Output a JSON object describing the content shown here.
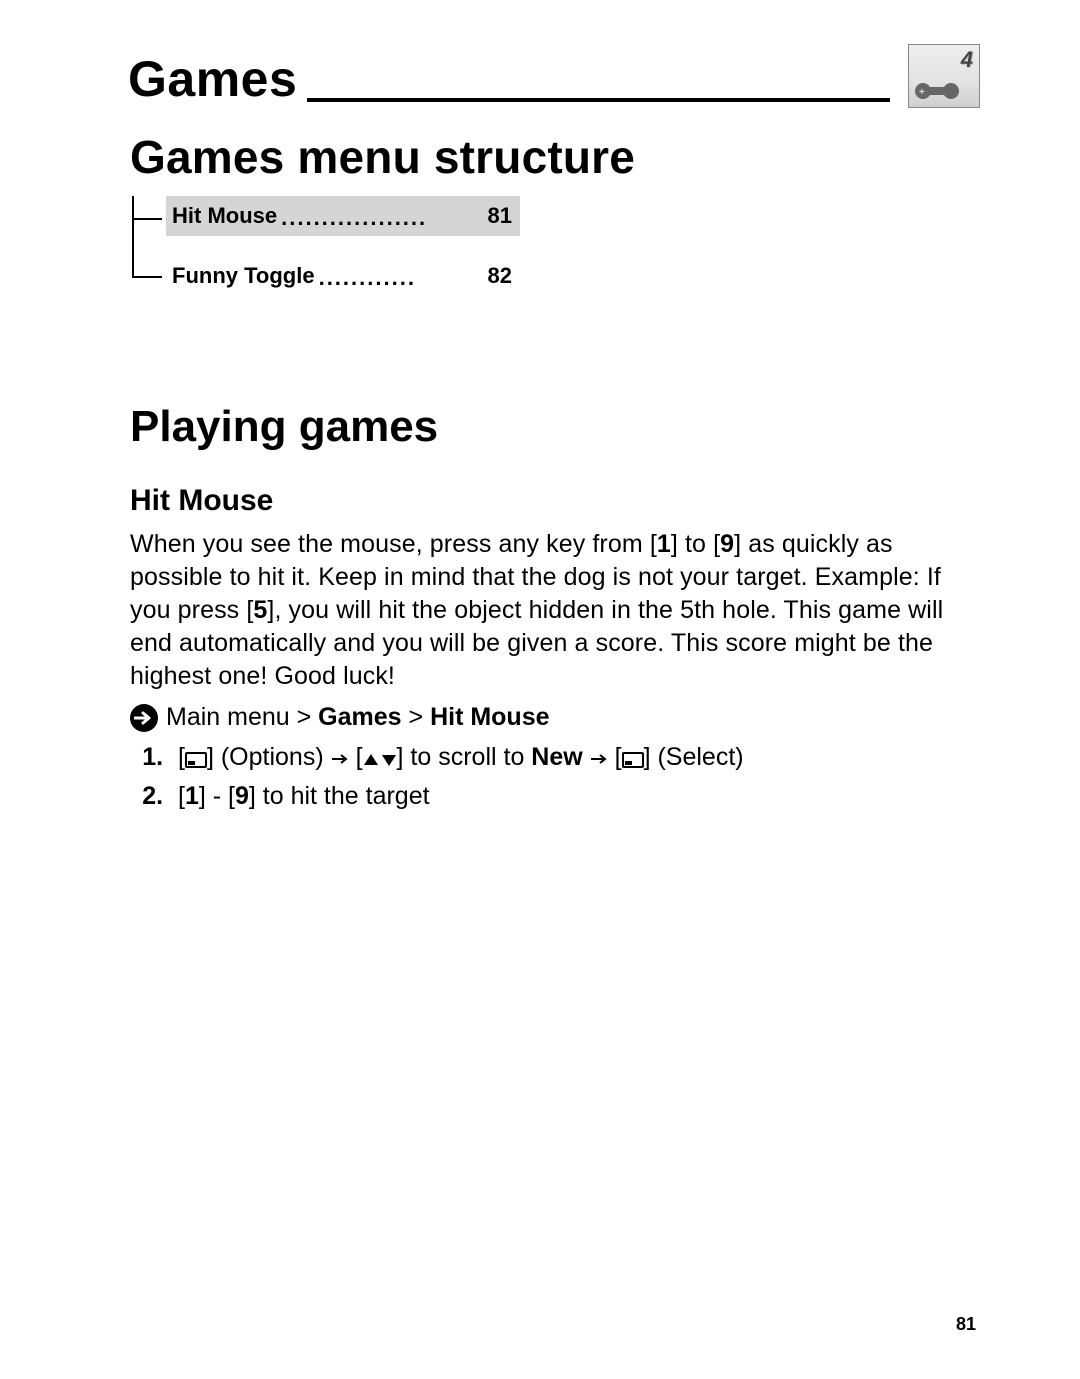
{
  "header": {
    "chapter_title": "Games",
    "icon_label": "4"
  },
  "section1": {
    "title": "Games menu structure",
    "toc": [
      {
        "label": "Hit Mouse",
        "page": "81",
        "shaded": true
      },
      {
        "label": "Funny Toggle",
        "page": "82",
        "shaded": false
      }
    ]
  },
  "section2": {
    "title": "Playing games",
    "subheading": "Hit Mouse",
    "paragraph_pre": "When you see the mouse, press any key from [",
    "key1": "1",
    "paragraph_mid1": "] to [",
    "key9": "9",
    "paragraph_mid2": "] as quickly as possible to hit it. Keep in mind that the dog is not your target. Example: If you press [",
    "key5": "5",
    "paragraph_post": "], you will hit the object hidden in the 5th hole. This game will end automatically and you will be given a score. This score might be the highest one! Good luck!",
    "nav": {
      "prefix": "Main menu > ",
      "b1": "Games",
      "sep": " > ",
      "b2": "Hit Mouse"
    },
    "steps": {
      "s1": {
        "lb": "[",
        "rb": "]",
        "options": " (Options) ",
        "slash": " / ",
        "scroll": " to scroll to ",
        "new": "New",
        "select": " (Select)"
      },
      "s2": {
        "lb1": "[",
        "k1": "1",
        "rb1": "]",
        "dash": " - ",
        "lb2": "[",
        "k9": "9",
        "rb2": "]",
        "tail": " to hit the target"
      }
    }
  },
  "footer": {
    "page_number": "81"
  }
}
